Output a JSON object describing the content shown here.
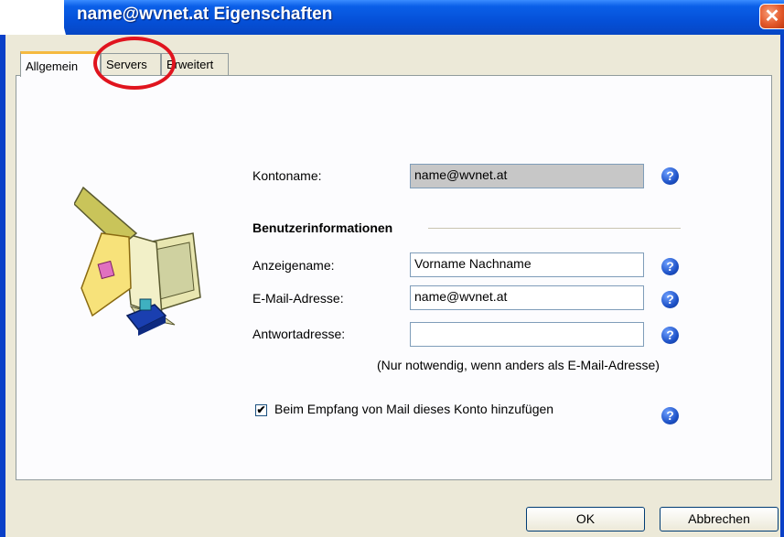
{
  "window": {
    "title": "name@wvnet.at Eigenschaften",
    "close_glyph": "✕"
  },
  "tabs": [
    {
      "label": "Allgemein",
      "active": true
    },
    {
      "label": "Servers",
      "active": false
    },
    {
      "label": "Erweitert",
      "active": false
    }
  ],
  "form": {
    "account_name_label": "Kontoname:",
    "account_name_value": "name@wvnet.at",
    "user_info_heading": "Benutzerinformationen",
    "display_name_label": "Anzeigename:",
    "display_name_value": "Vorname Nachname",
    "email_label": "E-Mail-Adresse:",
    "email_value": "name@wvnet.at",
    "reply_label": "Antwortadresse:",
    "reply_value": "",
    "reply_hint": "(Nur notwendig, wenn anders als E-Mail-Adresse)",
    "include_label": "Beim Empfang von Mail dieses Konto hinzufügen",
    "include_checked": true,
    "check_glyph": "✔",
    "help_glyph": "?"
  },
  "buttons": {
    "ok": "OK",
    "cancel": "Abbrechen"
  },
  "icons": {
    "illustration": "mail-computer-icon",
    "annotation": "red-circle-highlight"
  },
  "colors": {
    "titlebar": "#0550d8",
    "panel": "#fcfcfe",
    "dialog": "#ece9d8",
    "highlight": "#e0141e",
    "help": "#1f53c8"
  }
}
